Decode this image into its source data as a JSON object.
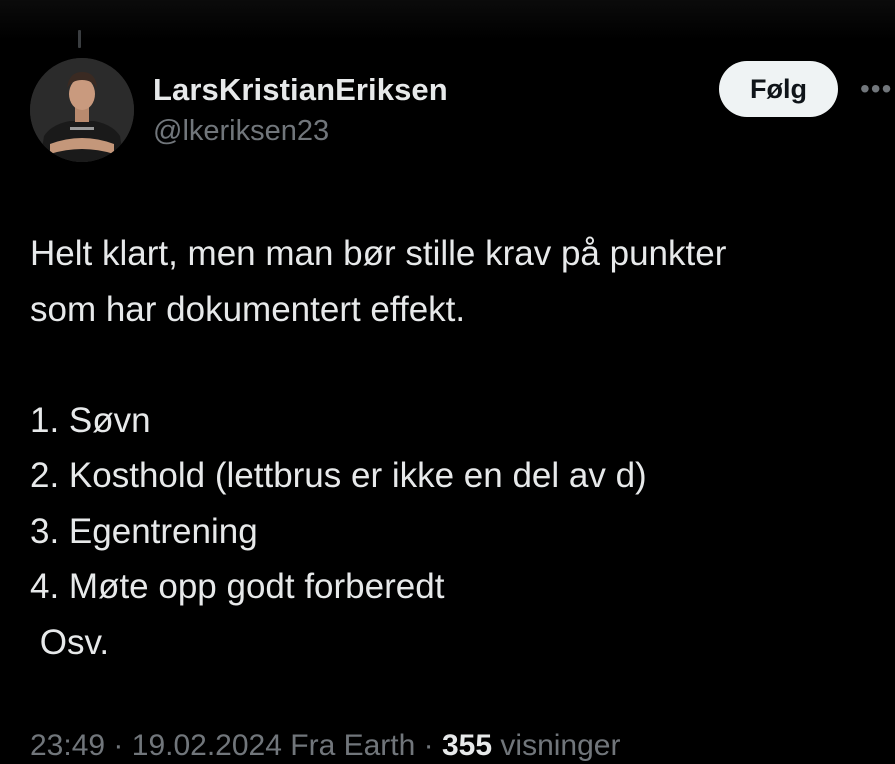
{
  "author": {
    "display_name": "LarsKristianEriksen",
    "handle": "@lkeriksen23",
    "avatar_icon": "profile-photo"
  },
  "follow_button": {
    "label": "Følg"
  },
  "more_menu": {
    "icon": "more-horizontal-icon"
  },
  "tweet": {
    "lines": [
      "Helt klart, men man bør stille krav på punkter",
      "som har dokumentert effekt.",
      "",
      "1. Søvn",
      "2. Kosthold (lettbrus er ikke en del av d)",
      "3. Egentrening",
      "4. Møte opp godt forberedt",
      " Osv."
    ]
  },
  "meta": {
    "time": "23:49",
    "date": "19.02.2024",
    "source": "Fra Earth",
    "separator": "·",
    "views_count": "355",
    "views_label": "visninger"
  },
  "colors": {
    "background": "#000000",
    "primary_text": "#e7e9ea",
    "secondary_text": "#71767b",
    "follow_button_bg": "#eff3f4"
  }
}
